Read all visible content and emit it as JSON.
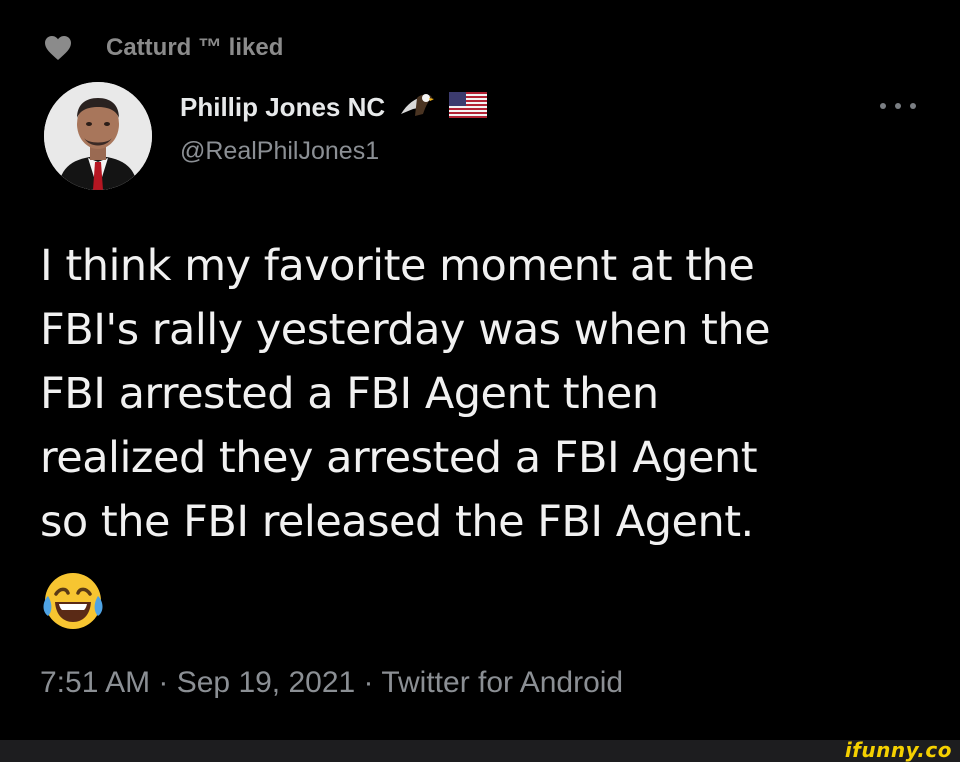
{
  "social_context": {
    "icon": "heart-icon",
    "text": "Catturd ™ liked"
  },
  "author": {
    "display_name": "Phillip Jones NC",
    "badges": [
      "eagle-icon",
      "us-flag-icon"
    ],
    "handle": "@RealPhilJones1",
    "avatar": "avatar"
  },
  "more_icon": "more-icon",
  "tweet": {
    "lines": [
      "I think my favorite moment at the",
      "FBI's rally yesterday was when the",
      "FBI arrested a FBI Agent then",
      "realized they arrested a FBI Agent",
      "so the FBI released the FBI Agent."
    ],
    "emoji": "face-with-tears-of-joy-icon"
  },
  "meta": "7:51 AM · Sep 19, 2021 · Twitter for Android",
  "watermark": "ifunny.co",
  "colors": {
    "background": "#000000",
    "text": "#f1f1f1",
    "muted": "#8b8f94",
    "watermark": "#f5d000"
  }
}
